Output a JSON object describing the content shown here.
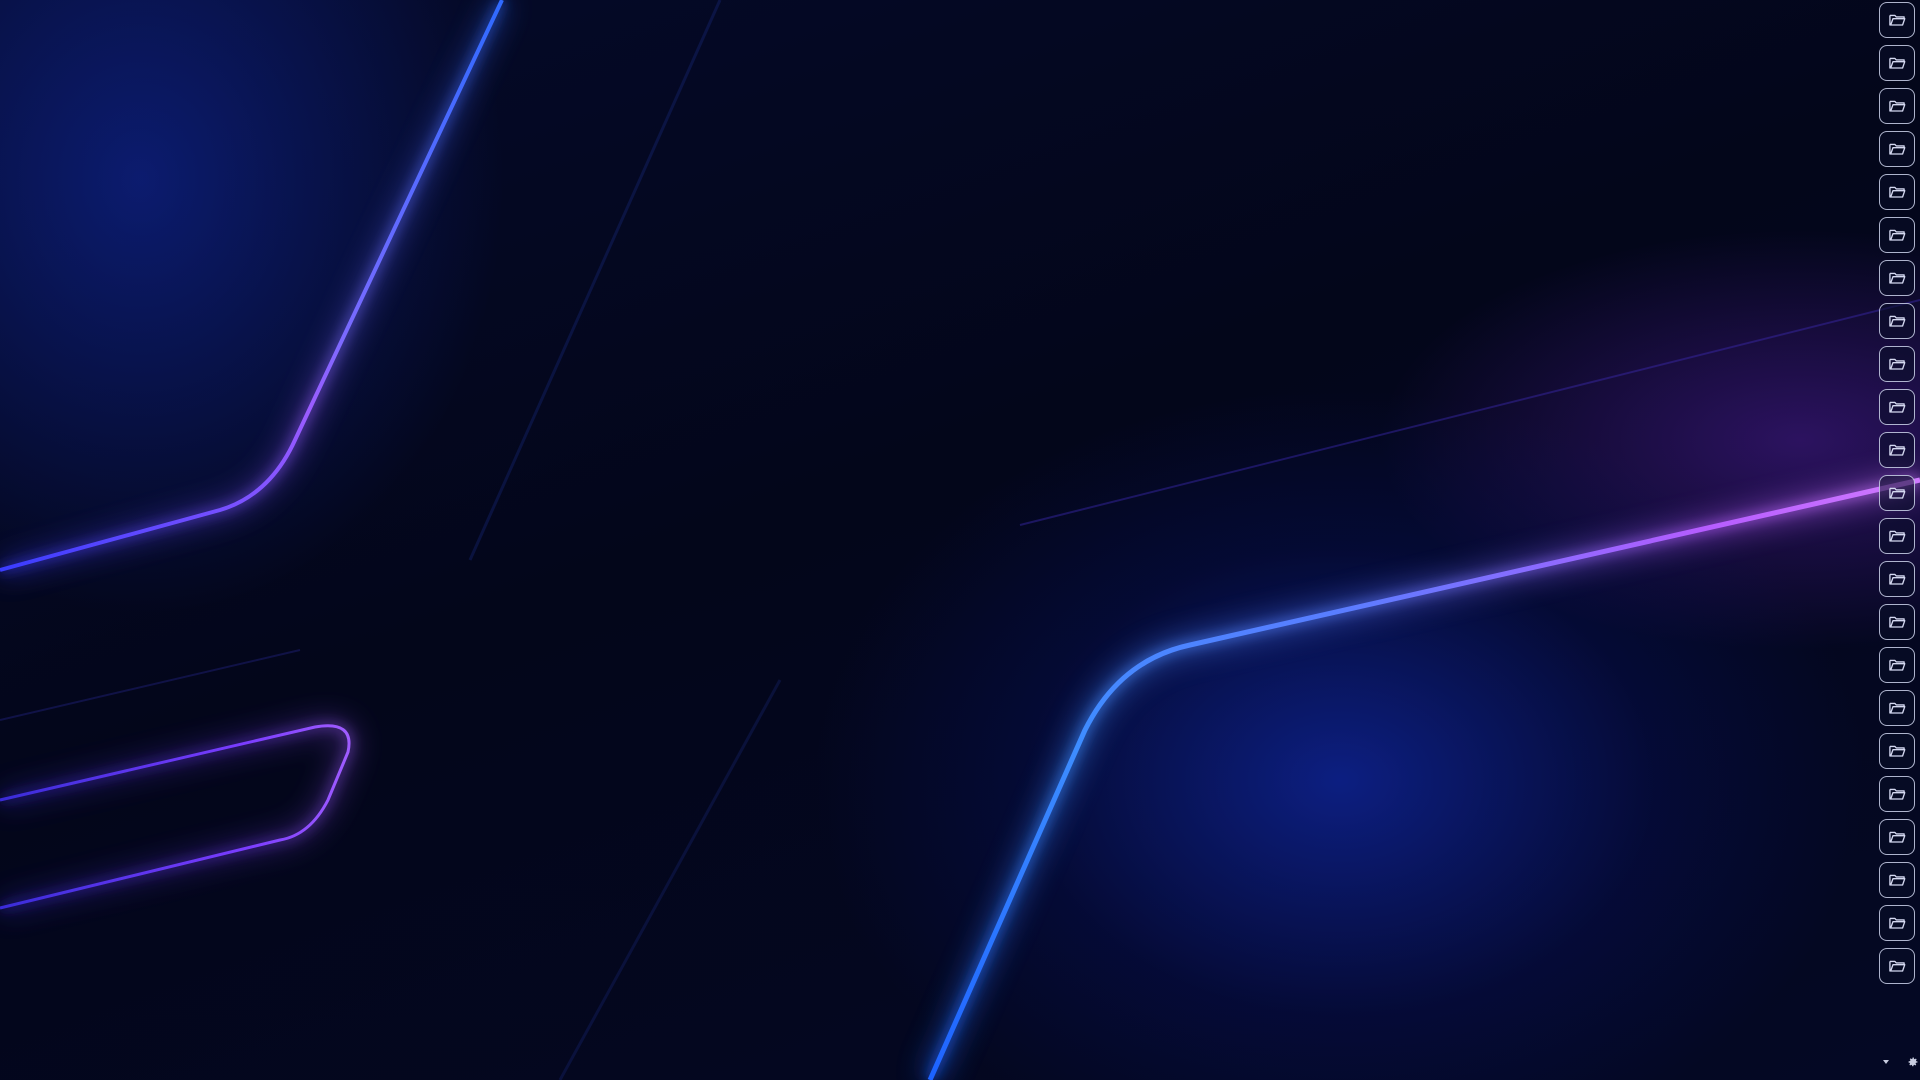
{
  "desktop": {
    "wallpaper": "abstract-neon-lines",
    "colors": {
      "background": "#03061a",
      "line_blue": "#2f6bff",
      "line_purple": "#b35cff"
    }
  },
  "dock": {
    "icon": "folder-open-icon",
    "icon_color": "#d4d8f0",
    "items": [
      {
        "icon": "folder-open-icon"
      },
      {
        "icon": "folder-open-icon"
      },
      {
        "icon": "folder-open-icon"
      },
      {
        "icon": "folder-open-icon"
      },
      {
        "icon": "folder-open-icon"
      },
      {
        "icon": "folder-open-icon"
      },
      {
        "icon": "folder-open-icon"
      },
      {
        "icon": "folder-open-icon"
      },
      {
        "icon": "folder-open-icon"
      },
      {
        "icon": "folder-open-icon"
      },
      {
        "icon": "folder-open-icon"
      },
      {
        "icon": "folder-open-icon"
      },
      {
        "icon": "folder-open-icon"
      },
      {
        "icon": "folder-open-icon"
      },
      {
        "icon": "folder-open-icon"
      },
      {
        "icon": "folder-open-icon"
      },
      {
        "icon": "folder-open-icon"
      },
      {
        "icon": "folder-open-icon"
      },
      {
        "icon": "folder-open-icon"
      },
      {
        "icon": "folder-open-icon"
      },
      {
        "icon": "folder-open-icon"
      },
      {
        "icon": "folder-open-icon"
      },
      {
        "icon": "folder-open-icon"
      }
    ]
  },
  "tray": {
    "icons": [
      "chevron-down-icon",
      "gear-icon"
    ],
    "icon_color": "#c8cce0"
  }
}
